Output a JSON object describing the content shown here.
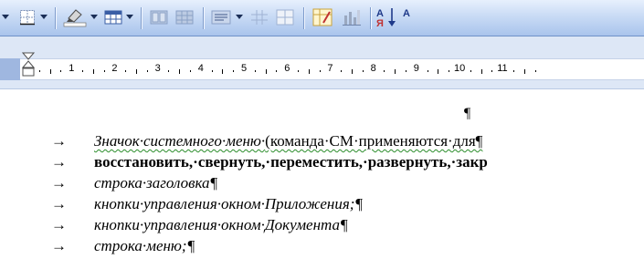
{
  "toolbar": {
    "icons": [
      "dropdown-arrow",
      "borders-icon",
      "highlight-color-icon",
      "insert-table-icon",
      "columns-icon",
      "excel-table-icon",
      "align-icon",
      "table-grid-icon",
      "merge-cells-icon",
      "autoformat-icon",
      "chart-icon",
      "sort-ascending-icon"
    ],
    "sort_label": "A",
    "sort_label_cyr": "Я"
  },
  "ruler": {
    "numbers": [
      "1",
      "2",
      "3",
      "4",
      "5",
      "6",
      "7",
      "8",
      "9",
      "10",
      "11"
    ]
  },
  "document": {
    "pilcrow": "¶",
    "arrow": "→",
    "lines": [
      {
        "parts": [
          {
            "text": "Значок·системного·меню·",
            "style": "italic squiggle"
          },
          {
            "text": "(команда·СМ·применяются·для¶",
            "style": "squiggle"
          }
        ]
      },
      {
        "parts": [
          {
            "text": "восстановить,·свернуть,·переместить,·развернуть,·закр",
            "style": "bold"
          }
        ]
      },
      {
        "parts": [
          {
            "text": "строка·заголовка¶",
            "style": "italic"
          }
        ]
      },
      {
        "parts": [
          {
            "text": "кнопки·управления·окном·Приложения;¶",
            "style": "italic"
          }
        ]
      },
      {
        "parts": [
          {
            "text": "кнопки·управления·окном·Документа¶",
            "style": "italic"
          }
        ]
      },
      {
        "parts": [
          {
            "text": "строка·меню;¶",
            "style": "italic"
          }
        ]
      }
    ]
  },
  "colors": {
    "toolbar_top": "#e7f0fd",
    "toolbar_bottom": "#a9c4ec",
    "ruler_bg": "#dde7f6",
    "grammar_squiggle": "#2a8c2a"
  }
}
